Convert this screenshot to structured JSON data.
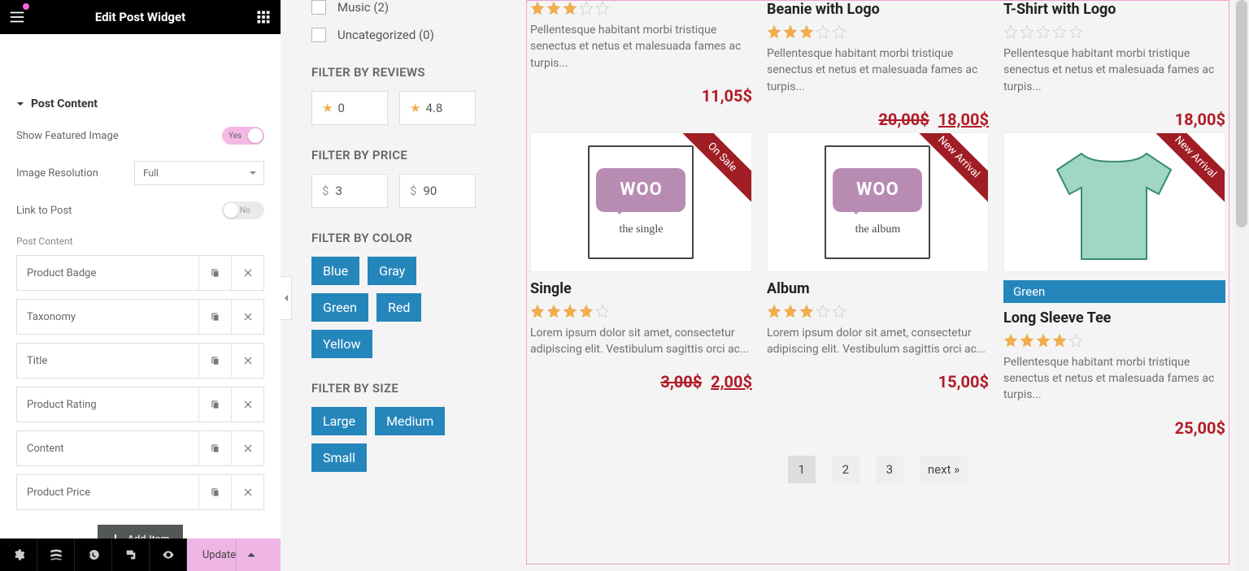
{
  "sidebar": {
    "title": "Edit Post Widget",
    "section": "Post Content",
    "rows": {
      "featured": {
        "label": "Show Featured Image",
        "value": "Yes"
      },
      "resolution": {
        "label": "Image Resolution",
        "value": "Full"
      },
      "link": {
        "label": "Link to Post",
        "value": "No"
      }
    },
    "itemsHead": "Post Content",
    "items": [
      "Product Badge",
      "Taxonomy",
      "Title",
      "Product Rating",
      "Content",
      "Product Price"
    ],
    "addItem": "Add Item",
    "update": "Update"
  },
  "filters": {
    "cats": [
      {
        "label": "Music (2)"
      },
      {
        "label": "Uncategorized (0)"
      }
    ],
    "reviews": {
      "head": "FILTER BY REVIEWS",
      "min": "0",
      "max": "4.8"
    },
    "price": {
      "head": "FILTER BY PRICE",
      "min": "3",
      "max": "90"
    },
    "color": {
      "head": "FILTER BY COLOR",
      "chips": [
        "Blue",
        "Gray",
        "Green",
        "Red",
        "Yellow"
      ]
    },
    "size": {
      "head": "FILTER BY SIZE",
      "chips": [
        "Large",
        "Medium",
        "Small"
      ]
    }
  },
  "products": {
    "topRow": [
      {
        "title": "",
        "rating": 3,
        "desc": "Pellentesque habitant morbi tristique senectus et netus et malesuada fames ac turpis...",
        "price": "11,05$"
      },
      {
        "title": "Beanie with Logo",
        "rating": 3,
        "desc": "Pellentesque habitant morbi tristique senectus et netus et malesuada fames ac turpis...",
        "oldPrice": "20,00$",
        "price": "18,00$"
      },
      {
        "title": "T-Shirt with Logo",
        "rating": 0,
        "desc": "Pellentesque habitant morbi tristique senectus et netus et malesuada fames ac turpis...",
        "price": "18,00$"
      }
    ],
    "bottomRow": [
      {
        "kind": "woo",
        "sub": "the  single",
        "ribbon": "On Sale",
        "title": "Single",
        "rating": 4,
        "desc": "Lorem ipsum dolor sit amet, consectetur adipiscing elit. Vestibulum sagittis orci ac...",
        "oldPrice": "3,00$",
        "price": "2,00$"
      },
      {
        "kind": "woo",
        "sub": "the  album",
        "ribbon": "New Arrival",
        "title": "Album",
        "rating": 3,
        "desc": "Lorem ipsum dolor sit amet, consectetur adipiscing elit. Vestibulum sagittis orci ac...",
        "price": "15,00$"
      },
      {
        "kind": "tee",
        "ribbon": "New Arrival",
        "badge": "Green",
        "title": "Long Sleeve Tee",
        "rating": 4,
        "desc": "Pellentesque habitant morbi tristique senectus et netus et malesuada fames ac turpis...",
        "price": "25,00$"
      }
    ]
  },
  "pager": {
    "pages": [
      "1",
      "2",
      "3"
    ],
    "next": "next »"
  }
}
